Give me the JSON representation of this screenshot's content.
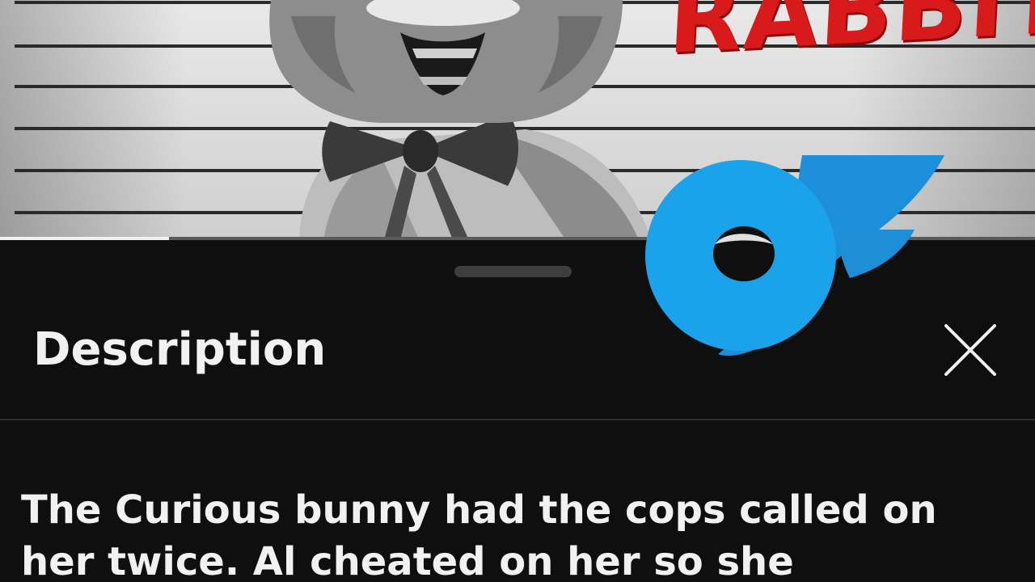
{
  "video": {
    "overlay_text": "RABBIT",
    "progress_fraction": 0.163
  },
  "sheet": {
    "title": "Description",
    "description": "The Curious bunny had the cops called on her twice. Al cheated on her so she"
  },
  "colors": {
    "background": "#0f0f0f",
    "text_primary": "#f1f1f1",
    "divider": "#303030",
    "handle": "#3d3d3d",
    "title_red": "#d91a1a",
    "logo_blue": "#1a9de6"
  },
  "icons": {
    "close": "close-icon",
    "overlay_logo": "onlyfans-logo-icon"
  }
}
